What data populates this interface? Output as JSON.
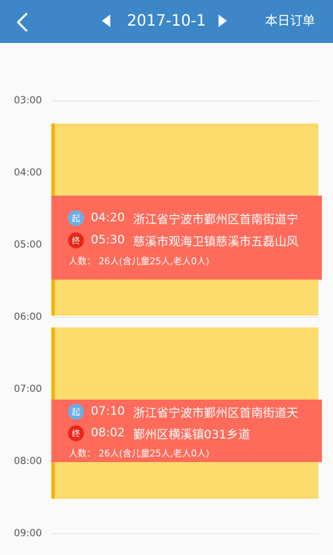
{
  "header": {
    "date": "2017-10-1",
    "today_orders_label": "本日订单",
    "back_icon": "chevron-left-icon",
    "prev_icon": "triangle-left-icon",
    "next_icon": "triangle-right-icon"
  },
  "timeline": {
    "hours": [
      "03:00",
      "04:00",
      "05:00",
      "06:00",
      "07:00",
      "08:00",
      "09:00"
    ]
  },
  "trips": [
    {
      "start_badge": "起",
      "start_time": "04:20",
      "start_place": "浙江省宁波市鄞州区首南街道宁",
      "end_badge": "终",
      "end_time": "05:30",
      "end_place": "慈溪市观海卫镇慈溪市五磊山风",
      "people": "人数： 26人(含儿童25人,老人0人)"
    },
    {
      "start_badge": "起",
      "start_time": "07:10",
      "start_place": "浙江省宁波市鄞州区首南街道天",
      "end_badge": "终",
      "end_time": "08:02",
      "end_place": "鄞州区横溪镇031乡道",
      "people": "人数： 26人(含儿童25人,老人0人)"
    }
  ],
  "colors": {
    "header_bg": "#3d87c8",
    "block_bg": "#fddb6d",
    "block_accent": "#f4b400",
    "detail_bg": "#fe6b5a",
    "start_badge": "#6aaee8",
    "end_badge": "#e8261b"
  }
}
